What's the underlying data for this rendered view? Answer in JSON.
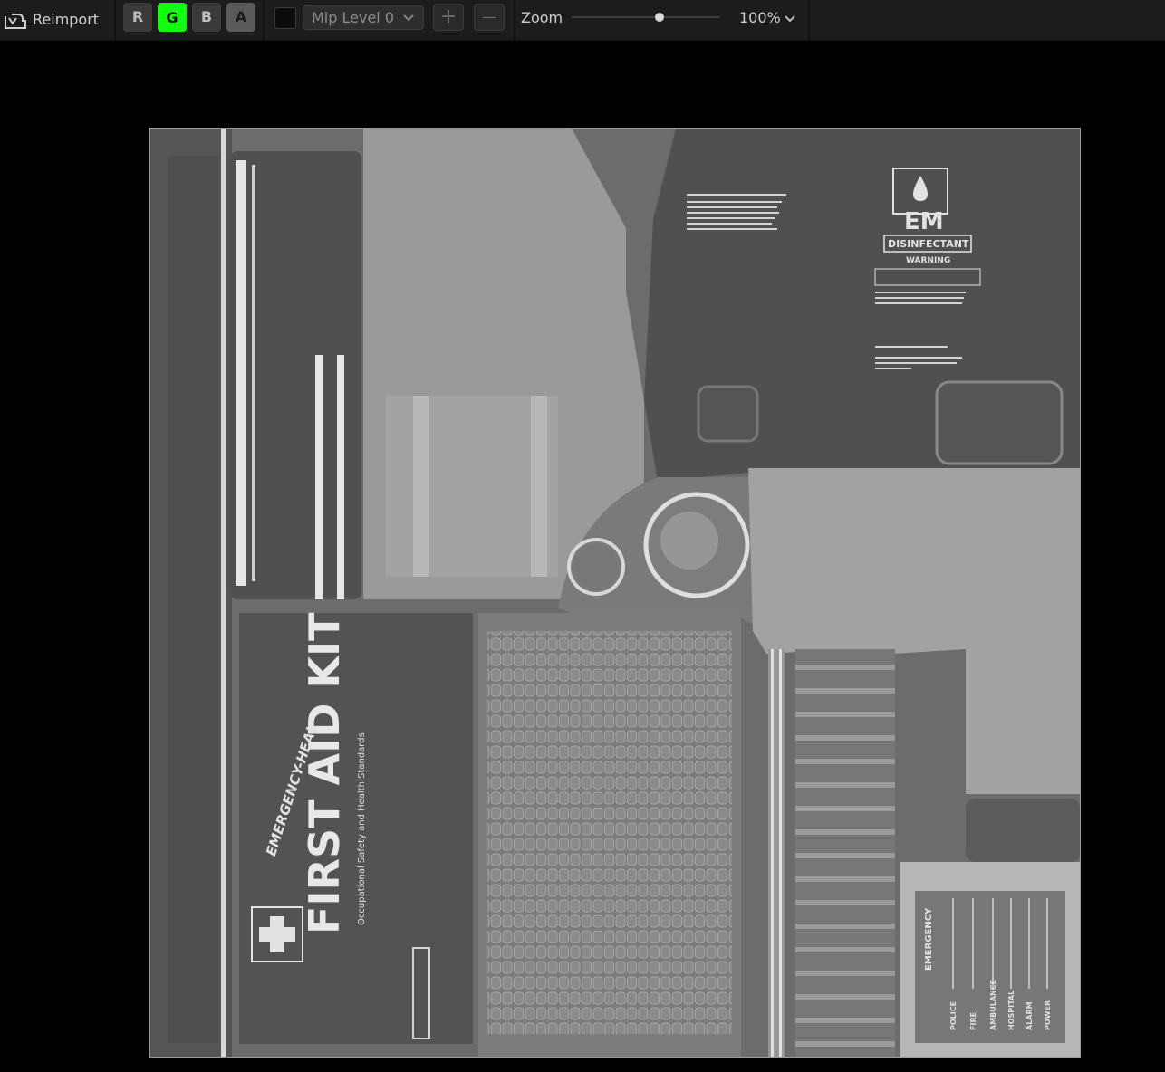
{
  "toolbar": {
    "reimport_label": "Reimport",
    "channels": [
      {
        "label": "R",
        "active": false
      },
      {
        "label": "G",
        "active": true
      },
      {
        "label": "B",
        "active": false
      },
      {
        "label": "A",
        "active": false
      }
    ],
    "mip_level": "Mip Level 0",
    "plus_symbol": "+",
    "minus_symbol": "—",
    "zoom_label": "Zoom",
    "zoom_percent": 100,
    "zoom_value": "100%"
  },
  "texture": {
    "kit_title": "FIRST AID KIT",
    "kit_subtitle": "Occupational Safety and Health Standards",
    "brand": "EMERGENCY-HEAL",
    "disinfectant_logo": "EM",
    "disinfectant_label": "DISINFECTANT",
    "warning_label": "WARNING",
    "emergency_label": "EMERGENCY",
    "emergency_items": [
      "POLICE",
      "FIRE",
      "AMBULANCE",
      "HOSPITAL",
      "ALARM",
      "POWER"
    ]
  },
  "colors": {
    "toolbar_bg": "#1c1c1c",
    "viewport_bg": "#000000",
    "green_channel_active": "#12ff12"
  }
}
